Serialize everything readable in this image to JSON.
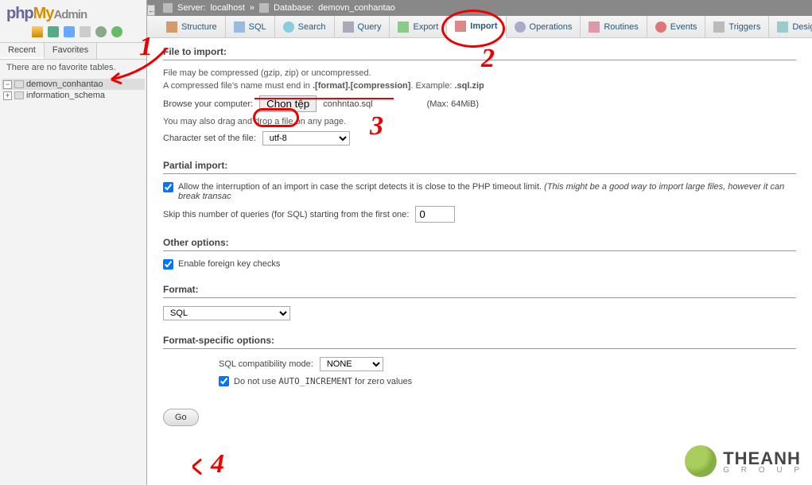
{
  "sidebar": {
    "logo_php": "php",
    "logo_my": "My",
    "logo_admin": "Admin",
    "tabs": [
      "Recent",
      "Favorites"
    ],
    "msg": "There are no favorite tables.",
    "dbs": [
      {
        "name": "demovn_conhantao",
        "selected": true,
        "expand": "−"
      },
      {
        "name": "information_schema",
        "selected": false,
        "expand": "+"
      }
    ]
  },
  "breadcrumb": {
    "server_label": "Server:",
    "server": "localhost",
    "sep": "»",
    "db_label": "Database:",
    "db": "demovn_conhantao"
  },
  "tabs": [
    {
      "id": "structure",
      "label": "Structure"
    },
    {
      "id": "sql",
      "label": "SQL"
    },
    {
      "id": "search",
      "label": "Search"
    },
    {
      "id": "query",
      "label": "Query"
    },
    {
      "id": "export",
      "label": "Export"
    },
    {
      "id": "import",
      "label": "Import",
      "active": true
    },
    {
      "id": "operations",
      "label": "Operations"
    },
    {
      "id": "routines",
      "label": "Routines"
    },
    {
      "id": "events",
      "label": "Events"
    },
    {
      "id": "triggers",
      "label": "Triggers"
    },
    {
      "id": "designer",
      "label": "Designer"
    }
  ],
  "file_section": {
    "title": "File to import:",
    "hint1": "File may be compressed (gzip, zip) or uncompressed.",
    "hint2a": "A compressed file's name must end in ",
    "hint2b": ".[format].[compression]",
    "hint2c": ". Example: ",
    "hint2d": ".sql.zip",
    "browse_label": "Browse your computer:",
    "choose_btn": "Chọn tệp",
    "filename": "conhntao.sql",
    "max_label": "(Max: 64MiB)",
    "drag_hint": "You may also drag and drop a file on any page.",
    "charset_label": "Character set of the file:",
    "charset_value": "utf-8"
  },
  "partial": {
    "title": "Partial import:",
    "allow_label_a": "Allow the interruption of an import in case the script detects it is close to the PHP timeout limit. ",
    "allow_label_b": "(This might be a good way to import large files, however it can break transac",
    "skip_label": "Skip this number of queries (for SQL) starting from the first one:",
    "skip_value": "0"
  },
  "other": {
    "title": "Other options:",
    "fk_label": "Enable foreign key checks"
  },
  "format": {
    "title": "Format:",
    "value": "SQL"
  },
  "specific": {
    "title": "Format-specific options:",
    "compat_label": "SQL compatibility mode:",
    "compat_value": "NONE",
    "autoinc_a": "Do not use ",
    "autoinc_b": "AUTO_INCREMENT",
    "autoinc_c": " for zero values"
  },
  "go_label": "Go",
  "watermark": {
    "main": "THEANH",
    "sub": "G R O U P"
  },
  "annot": {
    "one": "1",
    "two": "2",
    "three": "3",
    "four": "4"
  }
}
